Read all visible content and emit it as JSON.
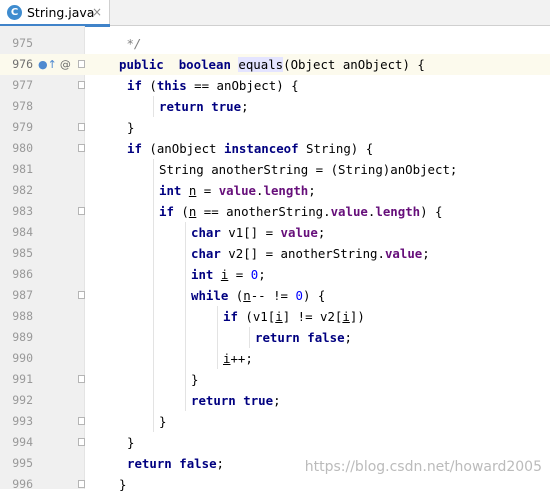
{
  "tab": {
    "icon": "java-class-icon",
    "icon_letter": "C",
    "title": "String.java",
    "close": "×"
  },
  "editor": {
    "colors": {
      "keyword": "#000080",
      "field": "#660e7a",
      "number": "#0000ff",
      "comment": "#808080",
      "current_line": "#fcfaed"
    },
    "lines": [
      {
        "n": "975",
        "indent": 1,
        "tokens": [
          [
            "cmt",
            " */"
          ]
        ]
      },
      {
        "n": "976",
        "indent": 1,
        "current": true,
        "marker": "override-method-icon",
        "marker_glyph": "●↑",
        "marker_extra": "@",
        "tokens": [
          [
            "kw",
            "public"
          ],
          [
            "",
            "  "
          ],
          [
            "kw",
            "boolean"
          ],
          [
            "",
            " "
          ],
          [
            "hl",
            "equals"
          ],
          [
            "",
            "(Object anObject) {"
          ]
        ]
      },
      {
        "n": "977",
        "indent": 2,
        "tokens": [
          [
            "kw",
            "if"
          ],
          [
            "",
            " ("
          ],
          [
            "kw",
            "this"
          ],
          [
            "",
            " == anObject) {"
          ]
        ]
      },
      {
        "n": "978",
        "indent": 3,
        "tokens": [
          [
            "kw",
            "return"
          ],
          [
            "",
            " "
          ],
          [
            "kw",
            "true"
          ],
          [
            "",
            ";"
          ]
        ]
      },
      {
        "n": "979",
        "indent": 2,
        "tokens": [
          [
            "",
            "}"
          ]
        ]
      },
      {
        "n": "980",
        "indent": 2,
        "tokens": [
          [
            "kw",
            "if"
          ],
          [
            "",
            " (anObject "
          ],
          [
            "kw",
            "instanceof"
          ],
          [
            "",
            " String) {"
          ]
        ]
      },
      {
        "n": "981",
        "indent": 3,
        "tokens": [
          [
            "",
            "String anotherString = (String)anObject;"
          ]
        ]
      },
      {
        "n": "982",
        "indent": 3,
        "tokens": [
          [
            "kw",
            "int"
          ],
          [
            "",
            " "
          ],
          [
            "ul",
            "n"
          ],
          [
            "",
            " = "
          ],
          [
            "field",
            "value"
          ],
          [
            "",
            "."
          ],
          [
            "field",
            "length"
          ],
          [
            "",
            ";"
          ]
        ]
      },
      {
        "n": "983",
        "indent": 3,
        "tokens": [
          [
            "kw",
            "if"
          ],
          [
            "",
            " ("
          ],
          [
            "ul",
            "n"
          ],
          [
            "",
            " == anotherString."
          ],
          [
            "field",
            "value"
          ],
          [
            "",
            "."
          ],
          [
            "field",
            "length"
          ],
          [
            "",
            ") {"
          ]
        ]
      },
      {
        "n": "984",
        "indent": 4,
        "tokens": [
          [
            "kw",
            "char"
          ],
          [
            "",
            " v1[] = "
          ],
          [
            "field",
            "value"
          ],
          [
            "",
            ";"
          ]
        ]
      },
      {
        "n": "985",
        "indent": 4,
        "tokens": [
          [
            "kw",
            "char"
          ],
          [
            "",
            " v2[] = anotherString."
          ],
          [
            "field",
            "value"
          ],
          [
            "",
            ";"
          ]
        ]
      },
      {
        "n": "986",
        "indent": 4,
        "tokens": [
          [
            "kw",
            "int"
          ],
          [
            "",
            " "
          ],
          [
            "ul",
            "i"
          ],
          [
            "",
            " = "
          ],
          [
            "num",
            "0"
          ],
          [
            "",
            ";"
          ]
        ]
      },
      {
        "n": "987",
        "indent": 4,
        "tokens": [
          [
            "kw",
            "while"
          ],
          [
            "",
            " ("
          ],
          [
            "ul",
            "n"
          ],
          [
            "",
            "-- != "
          ],
          [
            "num",
            "0"
          ],
          [
            "",
            ") {"
          ]
        ]
      },
      {
        "n": "988",
        "indent": 5,
        "tokens": [
          [
            "kw",
            "if"
          ],
          [
            "",
            " (v1["
          ],
          [
            "ul",
            "i"
          ],
          [
            "",
            "] != v2["
          ],
          [
            "ul",
            "i"
          ],
          [
            "",
            "])"
          ]
        ]
      },
      {
        "n": "989",
        "indent": 6,
        "tokens": [
          [
            "kw",
            "return"
          ],
          [
            "",
            " "
          ],
          [
            "kw",
            "false"
          ],
          [
            "",
            ";"
          ]
        ]
      },
      {
        "n": "990",
        "indent": 5,
        "tokens": [
          [
            "ul",
            "i"
          ],
          [
            "",
            "++;"
          ]
        ]
      },
      {
        "n": "991",
        "indent": 4,
        "tokens": [
          [
            "",
            "}"
          ]
        ]
      },
      {
        "n": "992",
        "indent": 4,
        "tokens": [
          [
            "kw",
            "return"
          ],
          [
            "",
            " "
          ],
          [
            "kw",
            "true"
          ],
          [
            "",
            ";"
          ]
        ]
      },
      {
        "n": "993",
        "indent": 3,
        "tokens": [
          [
            "",
            "}"
          ]
        ]
      },
      {
        "n": "994",
        "indent": 2,
        "tokens": [
          [
            "",
            "}"
          ]
        ]
      },
      {
        "n": "995",
        "indent": 2,
        "tokens": [
          [
            "kw",
            "return"
          ],
          [
            "",
            " "
          ],
          [
            "kw",
            "false"
          ],
          [
            "",
            ";"
          ]
        ]
      },
      {
        "n": "996",
        "indent": 1,
        "tokens": [
          [
            "",
            "}"
          ]
        ]
      }
    ]
  },
  "watermark": "https://blog.csdn.net/howard2005"
}
